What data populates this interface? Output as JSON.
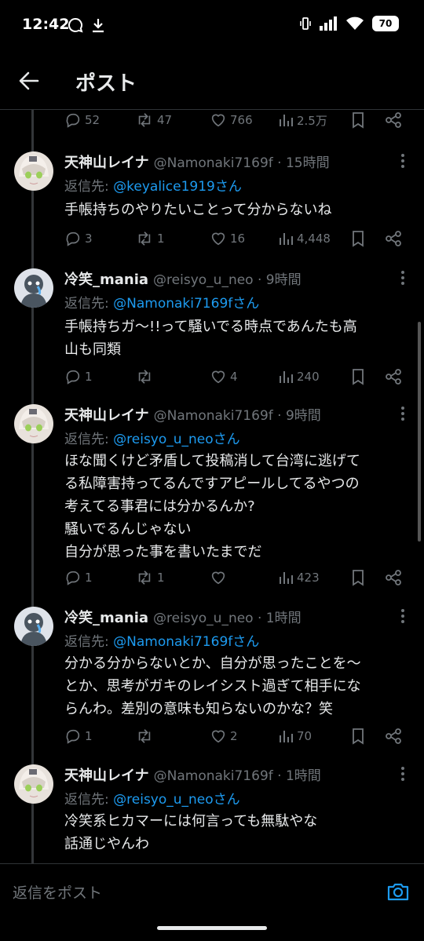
{
  "status_bar": {
    "time": "12:42",
    "battery": "70"
  },
  "header": {
    "title": "ポスト"
  },
  "top_actions": {
    "replies": "52",
    "reposts": "47",
    "likes": "766",
    "views": "2.5万"
  },
  "tweets": [
    {
      "name": "天神山レイナ",
      "handle": "@Namonaki7169f · 15時間",
      "reply_prefix": "返信先: ",
      "reply_mention": "@keyalice1919さん",
      "text": "手帳持ちのやりたいことって分からないね",
      "replies": "3",
      "reposts": "1",
      "likes": "16",
      "views": "4,448"
    },
    {
      "name": "冷笑_mania",
      "handle": "@reisyo_u_neo · 9時間",
      "reply_prefix": "返信先: ",
      "reply_mention": "@Namonaki7169fさん",
      "text": "手帳持ちガ〜!!って騒いでる時点であんたも高\n山も同類",
      "replies": "1",
      "reposts": "",
      "likes": "4",
      "views": "240"
    },
    {
      "name": "天神山レイナ",
      "handle": "@Namonaki7169f · 9時間",
      "reply_prefix": "返信先: ",
      "reply_mention": "@reisyo_u_neoさん",
      "text": "ほな聞くけど矛盾して投稿消して台湾に逃げて\nる私障害持ってるんですアピールしてるやつの\n考えてる事君には分かるんか?\n騒いでるんじゃない\n自分が思った事を書いたまでだ",
      "replies": "1",
      "reposts": "1",
      "likes": "",
      "views": "423"
    },
    {
      "name": "冷笑_mania",
      "handle": "@reisyo_u_neo · 1時間",
      "reply_prefix": "返信先: ",
      "reply_mention": "@Namonaki7169fさん",
      "text": "分かる分からないとか、自分が思ったことを〜\nとか、思考がガキのレイシスト過ぎて相手にな\nらんわ。差別の意味も知らないのかな？笑",
      "replies": "1",
      "reposts": "",
      "likes": "2",
      "views": "70"
    },
    {
      "name": "天神山レイナ",
      "handle": "@Namonaki7169f · 1時間",
      "reply_prefix": "返信先: ",
      "reply_mention": "@reisyo_u_neoさん",
      "text": "冷笑系ヒカマーには何言っても無駄やな\n話通じやんわ"
    }
  ],
  "reply_bar": {
    "placeholder": "返信をポスト"
  },
  "colors": {
    "background": "#000000",
    "text": "#e7e9ea",
    "muted": "#71767b",
    "accent": "#1d9bf0"
  }
}
